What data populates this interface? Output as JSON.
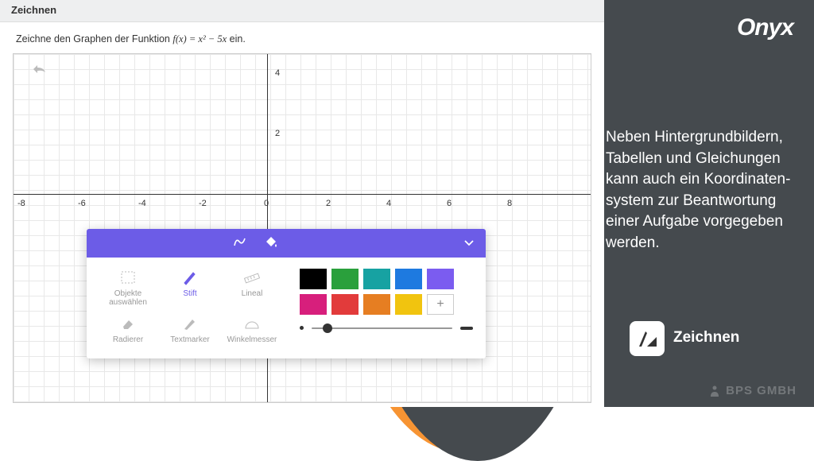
{
  "header": {
    "title": "Zeichnen"
  },
  "instruction": {
    "prefix": "Zeichne den Graphen der Funktion ",
    "formula": "f(x) = x² − 5x",
    "suffix": " ein."
  },
  "axes": {
    "xticks": [
      -8,
      -6,
      -4,
      -2,
      0,
      2,
      4,
      6,
      8
    ],
    "yticks": [
      2,
      4
    ]
  },
  "tools": {
    "items": [
      {
        "id": "select",
        "label": "Objekte auswählen"
      },
      {
        "id": "pen",
        "label": "Stift",
        "active": true
      },
      {
        "id": "ruler",
        "label": "Lineal"
      },
      {
        "id": "eraser",
        "label": "Radierer"
      },
      {
        "id": "marker",
        "label": "Textmarker"
      },
      {
        "id": "protractor",
        "label": "Winkelmesser"
      }
    ]
  },
  "colors": [
    "#000000",
    "#2aa03c",
    "#17a2a2",
    "#1e7ae0",
    "#7b5cf0",
    "#d71f7c",
    "#e23b3b",
    "#e67e22",
    "#f1c40f"
  ],
  "promo": {
    "logo": "Onyx",
    "text": "Neben Hintergrund­bildern, Tabellen und Gleichungen kann auch ein Koordinaten­system zur Beantwor­tung einer Aufgabe vorgegeben werden.",
    "badge_title": "Zeichnen",
    "company": "BPS GMBH"
  },
  "add_label": "+"
}
